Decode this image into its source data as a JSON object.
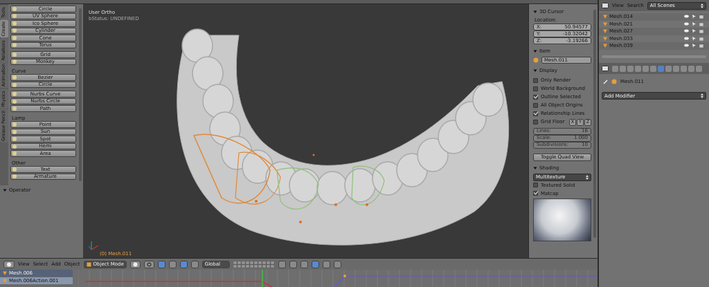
{
  "tool_shelf": {
    "tabs": [
      {
        "label": "Tools",
        "selected": false
      },
      {
        "label": "Create",
        "selected": true
      },
      {
        "label": "Relations",
        "selected": false
      },
      {
        "label": "Animation",
        "selected": false
      },
      {
        "label": "Physics",
        "selected": false
      },
      {
        "label": "Grease Pencil",
        "selected": false
      }
    ],
    "sections": [
      {
        "buttons": [
          "Circle",
          "UV Sphere",
          "Ico Sphere",
          "Cylinder",
          "Cone",
          "Torus"
        ]
      },
      {
        "buttons": [
          "Grid",
          "Monkey"
        ]
      },
      {
        "title": "Curve",
        "buttons": [
          "Bezier",
          "Circle"
        ]
      },
      {
        "buttons": [
          "Nurbs Curve",
          "Nurbs Circle",
          "Path"
        ]
      },
      {
        "title": "Lamp",
        "buttons": [
          "Point",
          "Sun",
          "Spot",
          "Hemi",
          "Area"
        ]
      },
      {
        "title": "Other",
        "buttons": [
          "Text",
          "Armature"
        ]
      }
    ],
    "operator": {
      "title": "Operator",
      "expanded": true
    }
  },
  "viewport": {
    "view_name": "User Ortho",
    "status": "bStatus: UNDEFINED",
    "active_object": "(0) Mesh.011"
  },
  "n_panel": {
    "cursor": {
      "title": "3D Cursor",
      "location_label": "Location:",
      "fields": [
        {
          "label": "X:",
          "value": "50.94577"
        },
        {
          "label": "Y:",
          "value": "-10.32042"
        },
        {
          "label": "Z:",
          "value": "-3.19266"
        }
      ]
    },
    "item": {
      "title": "Item",
      "name": "Mesh.011"
    },
    "display": {
      "title": "Display",
      "options": [
        {
          "label": "Only Render",
          "checked": false
        },
        {
          "label": "World Background",
          "checked": false
        },
        {
          "label": "Outline Selected",
          "checked": true
        },
        {
          "label": "All Object Origins",
          "checked": false
        },
        {
          "label": "Relationship Lines",
          "checked": true
        }
      ],
      "grid_floor": {
        "label": "Grid Floor",
        "checked": false,
        "axes": [
          "X",
          "Y",
          "Z"
        ]
      },
      "fields": [
        {
          "label": "Lines:",
          "value": "16"
        },
        {
          "label": "Scale:",
          "value": "1.000"
        },
        {
          "label": "Subdivisions:",
          "value": "10"
        }
      ],
      "button": "Toggle Quad View"
    },
    "shading": {
      "title": "Shading",
      "mode": "Multitexture",
      "options": [
        {
          "label": "Textured Solid",
          "checked": false
        },
        {
          "label": "Matcap",
          "checked": true
        }
      ]
    }
  },
  "outliner": {
    "menus": [
      "View",
      "Search"
    ],
    "scene": "All Scenes",
    "rows": [
      "Mesh.014",
      "Mesh.021",
      "Mesh.027",
      "Mesh.033",
      "Mesh.039"
    ]
  },
  "properties": {
    "tabs": [
      {
        "selected": false
      },
      {
        "selected": false
      },
      {
        "selected": false
      },
      {
        "selected": false
      },
      {
        "selected": false
      },
      {
        "selected": false
      },
      {
        "selected": true
      },
      {
        "selected": false
      },
      {
        "selected": false
      },
      {
        "selected": false
      },
      {
        "selected": false
      },
      {
        "selected": false
      }
    ],
    "object": "Mesh.011",
    "add_modifier": "Add Modifier"
  },
  "header": {
    "menus": [
      "View",
      "Select",
      "Add",
      "Object"
    ],
    "mode": "Object Mode",
    "orientation": "Global"
  },
  "timeline": {
    "rows": [
      "Mesh.006",
      "Mesh.006Action.001"
    ]
  }
}
